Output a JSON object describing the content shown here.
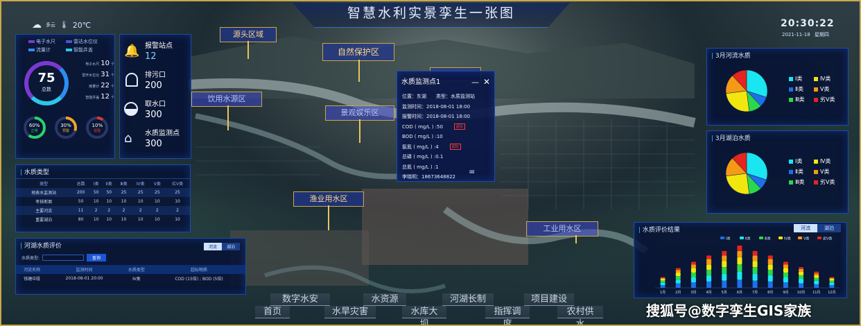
{
  "header": {
    "title": "智慧水利实景孪生一张图",
    "time": "20:30:22",
    "date": "2021-11-18",
    "weekday": "星期四",
    "weather": "多云",
    "temperature": "20℃"
  },
  "stats": {
    "legend": [
      "电子水尺",
      "雷达水位仪",
      "流量计",
      "智能井盖"
    ],
    "total_value": "75",
    "total_label": "总数",
    "rows": [
      {
        "label": "电子水尺",
        "value": "10",
        "unit": "个"
      },
      {
        "label": "雷开水位仪",
        "value": "31",
        "unit": "个"
      },
      {
        "label": "雨量计",
        "value": "22",
        "unit": "个"
      },
      {
        "label": "智能井盖",
        "value": "12",
        "unit": "个"
      }
    ],
    "gauges": [
      {
        "pct": "60%",
        "label": "正常",
        "color": "#27d46b",
        "fill": 0.6
      },
      {
        "pct": "30%",
        "label": "预警",
        "color": "#f0a52a",
        "fill": 0.3
      },
      {
        "pct": "10%",
        "label": "报警",
        "color": "#e0362f",
        "fill": 0.1
      }
    ]
  },
  "stations": [
    {
      "label": "报警站点",
      "value": "12"
    },
    {
      "label": "排污口",
      "value": "200"
    },
    {
      "label": "取水口",
      "value": "300"
    },
    {
      "label": "水质监测点",
      "value": "300"
    }
  ],
  "water_types": {
    "title": "水质类型",
    "headers": [
      "类型",
      "总数",
      "Ⅰ类",
      "Ⅱ类",
      "Ⅲ类",
      "Ⅳ类",
      "Ⅴ类",
      "劣Ⅴ类"
    ],
    "rows": [
      [
        "地表水监测站",
        "200",
        "50",
        "50",
        "25",
        "25",
        "25",
        "25"
      ],
      [
        "考核断面",
        "50",
        "10",
        "10",
        "10",
        "10",
        "10",
        "10"
      ],
      [
        "主要河流",
        "11",
        "2",
        "2",
        "2",
        "2",
        "2",
        "2"
      ],
      [
        "重要湖泊",
        "80",
        "10",
        "10",
        "10",
        "10",
        "10",
        "10"
      ]
    ]
  },
  "river_eval": {
    "title": "河湖水质评价",
    "tabs": [
      "河流",
      "湖泊"
    ],
    "filter_label": "水质类型:",
    "button": "查询",
    "headers": [
      "河流名称",
      "监测时间",
      "水质类型",
      "超标物质"
    ],
    "row": [
      "钱塘中段",
      "2018-08-01 20:00",
      "Ⅳ类",
      "COD (15倍) ; BOD (5倍)"
    ]
  },
  "map_tags": [
    "源头区域",
    "自然保护区",
    "饮用水源区",
    "景观娱乐区",
    "渔业用水区",
    "工业用水区"
  ],
  "popup": {
    "title": "水质监测点1",
    "lines": [
      {
        "text": "位置：东湖",
        "extra": "类型：水质监测站"
      },
      {
        "text": "监测时间：2018-08-01   18:00"
      },
      {
        "text": "报警时间：2018-08-01   18:00"
      },
      {
        "text": "COD ( mg/L ) :50",
        "badge": "超标"
      },
      {
        "text": "BOD ( mg/L ) :10"
      },
      {
        "text": "氨氮 ( mg/L ) :4",
        "badge": "超标"
      },
      {
        "text": "总磷 ( mg/L ) :0.1"
      },
      {
        "text": "总氮 ( mg/L ) :1"
      },
      {
        "text": "李晓明：18673648822"
      }
    ]
  },
  "river_quality": {
    "title": "3月河流水质",
    "legend": [
      {
        "name": "Ⅰ类",
        "color": "#19e6f0"
      },
      {
        "name": "Ⅳ类",
        "color": "#f2e60f"
      },
      {
        "name": "Ⅱ类",
        "color": "#1f6fe6"
      },
      {
        "name": "Ⅴ类",
        "color": "#f59a15"
      },
      {
        "name": "Ⅲ类",
        "color": "#2bd84b"
      },
      {
        "name": "劣Ⅴ类",
        "color": "#e3261e"
      }
    ]
  },
  "lake_quality": {
    "title": "3月湖泊水质",
    "legend": [
      {
        "name": "Ⅰ类",
        "color": "#19e6f0"
      },
      {
        "name": "Ⅳ类",
        "color": "#f2e60f"
      },
      {
        "name": "Ⅱ类",
        "color": "#1f6fe6"
      },
      {
        "name": "Ⅴ类",
        "color": "#f59a15"
      },
      {
        "name": "Ⅲ类",
        "color": "#2bd84b"
      },
      {
        "name": "劣Ⅴ类",
        "color": "#e3261e"
      }
    ]
  },
  "eval_chart": {
    "title": "水质评价结果",
    "tabs": [
      "河流",
      "湖泊"
    ]
  },
  "nav": {
    "top": [
      "数字水安",
      "水资源",
      "河湖长制",
      "项目建设"
    ],
    "bottom": [
      "首页",
      "水旱灾害",
      "水库大坝",
      "指挥调度",
      "农村供水"
    ]
  },
  "watermark": "搜狐号@数字孪生GIS家族",
  "chart_data": [
    {
      "type": "pie",
      "title": "3月河流水质",
      "categories": [
        "Ⅰ类",
        "Ⅱ类",
        "Ⅲ类",
        "Ⅳ类",
        "Ⅴ类",
        "劣Ⅴ类"
      ],
      "values": [
        30,
        8,
        10,
        25,
        15,
        12
      ],
      "colors": [
        "#19e6f0",
        "#1f6fe6",
        "#2bd84b",
        "#f2e60f",
        "#f59a15",
        "#e3261e"
      ]
    },
    {
      "type": "pie",
      "title": "3月湖泊水质",
      "categories": [
        "Ⅰ类",
        "Ⅱ类",
        "Ⅲ类",
        "Ⅳ类",
        "Ⅴ类",
        "劣Ⅴ类"
      ],
      "values": [
        30,
        8,
        10,
        25,
        15,
        12
      ],
      "colors": [
        "#19e6f0",
        "#1f6fe6",
        "#2bd84b",
        "#f2e60f",
        "#f59a15",
        "#e3261e"
      ]
    },
    {
      "type": "bar",
      "title": "水质评价结果",
      "stacked": true,
      "categories": [
        "1月",
        "2月",
        "3月",
        "4月",
        "5月",
        "6月",
        "7月",
        "8月",
        "9月",
        "10月",
        "11月",
        "12月"
      ],
      "series": [
        {
          "name": "Ⅰ类",
          "color": "#1f6fe6",
          "values": [
            3,
            5,
            6,
            7,
            8,
            9,
            8,
            7,
            6,
            5,
            4,
            3
          ]
        },
        {
          "name": "Ⅱ类",
          "color": "#19e6f0",
          "values": [
            3,
            4,
            6,
            7,
            8,
            9,
            8,
            7,
            6,
            5,
            4,
            3
          ]
        },
        {
          "name": "Ⅲ类",
          "color": "#2bd84b",
          "values": [
            2,
            4,
            5,
            6,
            7,
            8,
            7,
            6,
            5,
            4,
            3,
            2
          ]
        },
        {
          "name": "Ⅳ类",
          "color": "#f2e60f",
          "values": [
            2,
            4,
            5,
            6,
            7,
            8,
            7,
            6,
            5,
            4,
            3,
            2
          ]
        },
        {
          "name": "Ⅴ类",
          "color": "#f59a15",
          "values": [
            1,
            3,
            4,
            6,
            6,
            7,
            6,
            6,
            4,
            3,
            2,
            1
          ]
        },
        {
          "name": "劣Ⅴ类",
          "color": "#e3261e",
          "values": [
            1,
            2,
            3,
            4,
            5,
            6,
            5,
            4,
            3,
            2,
            2,
            1
          ]
        }
      ]
    }
  ]
}
